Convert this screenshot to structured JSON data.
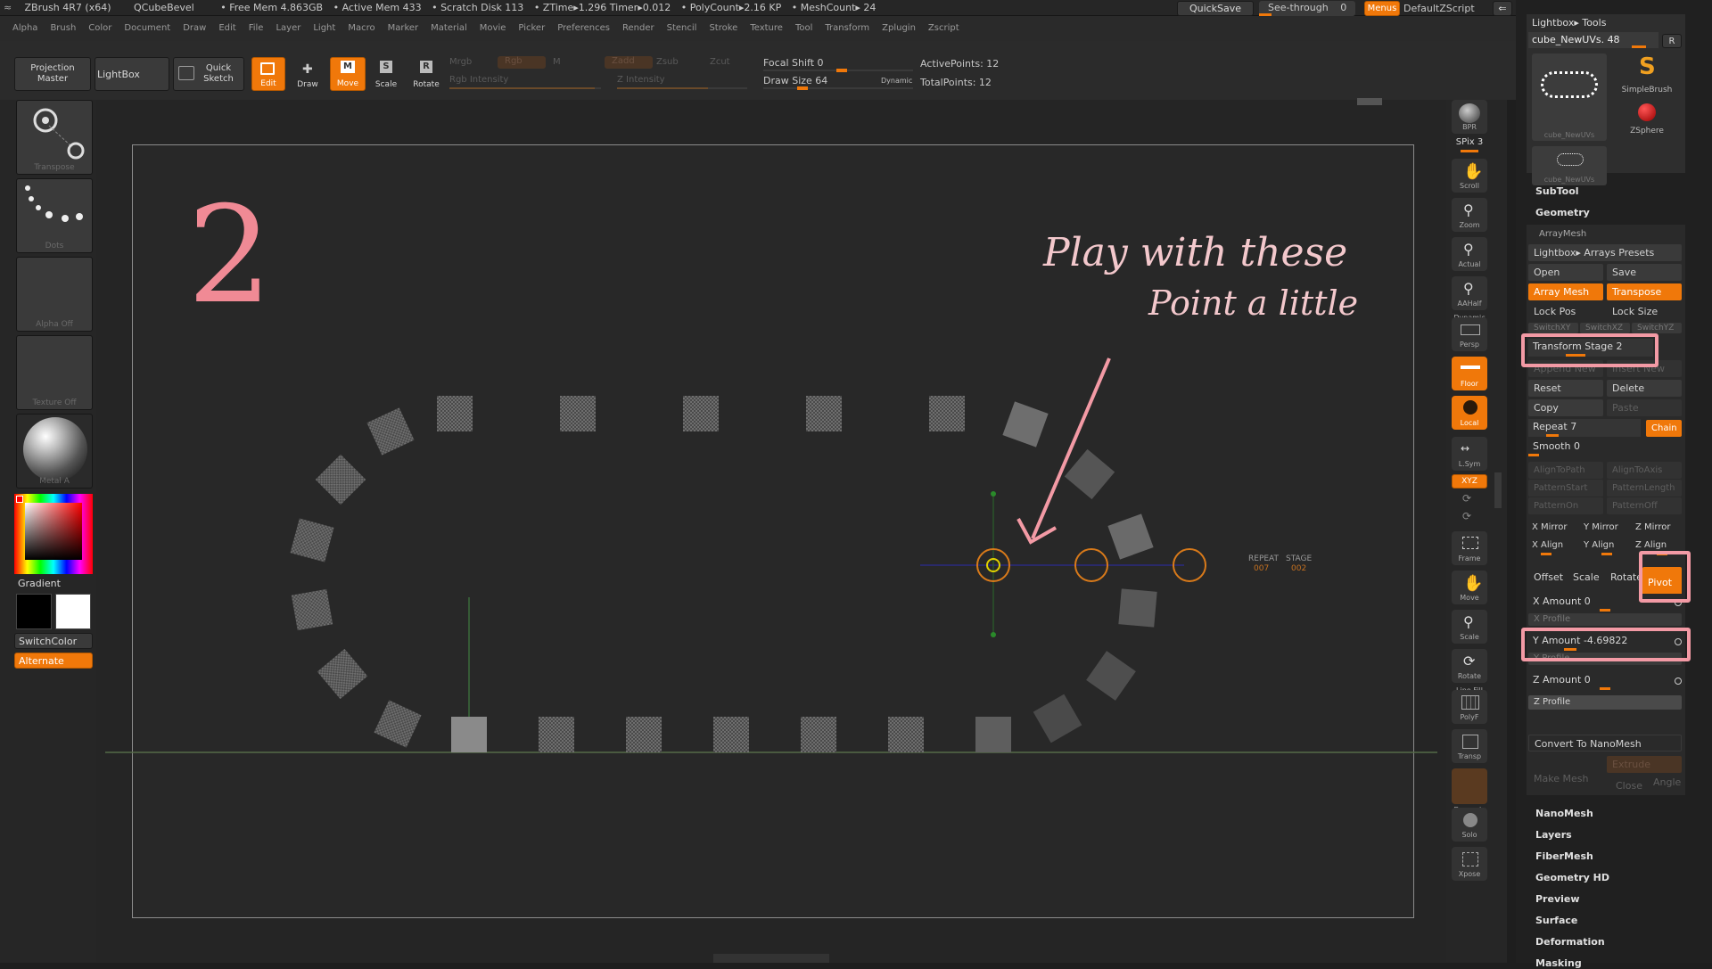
{
  "topbar": {
    "app": "ZBrush 4R7 (x64)",
    "doc": "QCubeBevel",
    "free_mem": "• Free Mem 4.863GB",
    "active_mem": "• Active Mem 433",
    "scratch": "• Scratch Disk 113",
    "ztime": "• ZTime▸1.296 Timer▸0.012",
    "polycount": "• PolyCount▸2.16 KP",
    "meshcount": "• MeshCount▸ 24",
    "quicksave": "QuickSave",
    "see_through": "See-through",
    "see_through_val": "0",
    "menus": "Menus",
    "script": "DefaultZScript"
  },
  "menus": [
    "Alpha",
    "Brush",
    "Color",
    "Document",
    "Draw",
    "Edit",
    "File",
    "Layer",
    "Light",
    "Macro",
    "Marker",
    "Material",
    "Movie",
    "Picker",
    "Preferences",
    "Render",
    "Stencil",
    "Stroke",
    "Texture",
    "Tool",
    "Transform",
    "Zplugin",
    "Zscript"
  ],
  "shelf": {
    "projection_master": "Projection Master",
    "lightbox": "LightBox",
    "quick_sketch": "Quick Sketch",
    "edit": "Edit",
    "draw": "Draw",
    "move": "Move",
    "scale": "Scale",
    "rotate": "Rotate",
    "mrgb": "Mrgb",
    "rgb": "Rgb",
    "m": "M",
    "rgb_intensity": "Rgb Intensity",
    "zadd": "Zadd",
    "zsub": "Zsub",
    "zcut": "Zcut",
    "z_intensity": "Z Intensity",
    "focal_shift": "Focal Shift 0",
    "draw_size": "Draw Size 64",
    "dynamic": "Dynamic",
    "active_points": "ActivePoints: 12",
    "total_points": "TotalPoints: 12"
  },
  "left": {
    "transpose": "Transpose",
    "dots": "Dots",
    "alpha": "Alpha Off",
    "texture": "Texture Off",
    "material": "Metal A",
    "gradient": "Gradient",
    "switchcolor": "SwitchColor",
    "alternate": "Alternate"
  },
  "right": [
    "BPR",
    "SPix 3",
    "Scroll",
    "Zoom",
    "Actual",
    "AAHalf",
    "Persp",
    "Floor",
    "Local",
    "L.Sym",
    "XYZ",
    "Frame",
    "Move",
    "Scale",
    "Rotate",
    "PolyF",
    "Transp",
    "Solo",
    "Xpose"
  ],
  "right_labels": {
    "dynamic": "Dynamic",
    "line_fill": "Line Fill"
  },
  "canvas": {
    "annotation_number": "2",
    "annotation_line1": "Play with these",
    "annotation_line2": "Point a little",
    "repeat_label": "REPEAT",
    "repeat_value": "007",
    "stage_label": "STAGE",
    "stage_value": "002"
  },
  "tool": {
    "header": "Lightbox▸ Tools",
    "current": "cube_NewUVs. 48",
    "r": "R",
    "thumb1": "cube_NewUVs",
    "thumb2": "SimpleBrush",
    "thumb3": "ZSphere",
    "thumb4": "cube_NewUVs"
  },
  "sections_top": [
    "SubTool",
    "Geometry"
  ],
  "arraymesh": {
    "title": "ArrayMesh",
    "presets": "Lightbox▸ Arrays Presets",
    "open": "Open",
    "save": "Save",
    "array_mesh": "Array Mesh",
    "transpose": "Transpose",
    "lock_pos": "Lock Pos",
    "lock_size": "Lock Size",
    "switch_xy": "SwitchXY",
    "switch_xz": "SwitchXZ",
    "switch_yz": "SwitchYZ",
    "transform_stage": "Transform Stage 2",
    "append_new": "Append New",
    "insert_new": "Insert New",
    "reset": "Reset",
    "delete": "Delete",
    "copy": "Copy",
    "paste": "Paste",
    "repeat": "Repeat 7",
    "chain": "Chain",
    "smooth": "Smooth 0",
    "align_to_path": "AlignToPath",
    "align_to_axis": "AlignToAxis",
    "pattern_start": "PatternStart",
    "pattern_length": "PatternLength",
    "pattern_on": "PatternOn",
    "pattern_off": "PatternOff",
    "x_mirror": "X Mirror",
    "y_mirror": "Y Mirror",
    "z_mirror": "Z Mirror",
    "x_align": "X Align",
    "y_align": "Y Align",
    "z_align": "Z Align",
    "offset": "Offset",
    "scale": "Scale",
    "rotate": "Rotate",
    "pivot": "Pivot",
    "x_amount": "X Amount 0",
    "x_profile": "X Profile",
    "y_amount": "Y Amount -4.69822",
    "y_profile": "Y Profile",
    "z_amount": "Z Amount 0",
    "z_profile": "Z Profile",
    "convert": "Convert To NanoMesh",
    "extrude": "Extrude",
    "make_mesh": "Make Mesh",
    "close": "Close",
    "angle": "Angle"
  },
  "sections_bottom": [
    "NanoMesh",
    "Layers",
    "FiberMesh",
    "Geometry HD",
    "Preview",
    "Surface",
    "Deformation",
    "Masking"
  ],
  "colors": {
    "accent": "#f0780a",
    "annotation": "#f39aa5"
  },
  "icons": [
    "transpose-icon",
    "dots-brush-icon",
    "color-picker-icon",
    "hand-scroll-icon",
    "zoom-icon",
    "persp-icon",
    "floor-icon",
    "local-icon",
    "frame-icon",
    "move-icon",
    "scale-icon",
    "rotate-icon"
  ]
}
